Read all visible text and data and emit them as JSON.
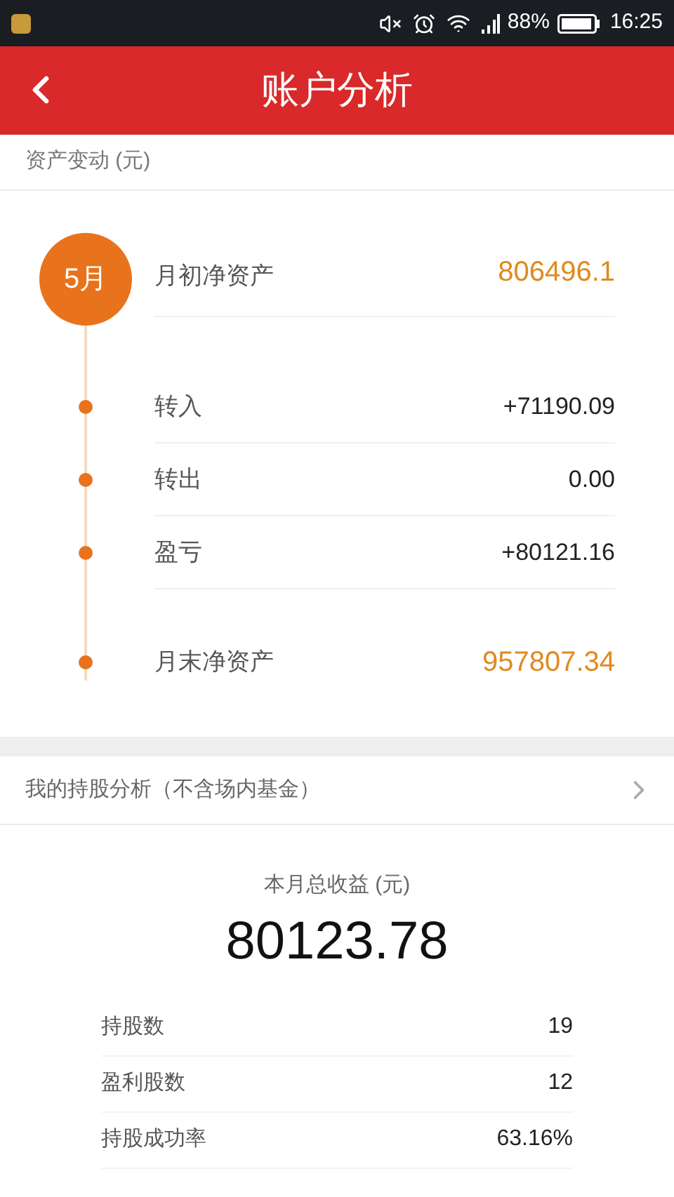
{
  "status_bar": {
    "battery": "88%",
    "time": "16:25"
  },
  "header": {
    "title": "账户分析"
  },
  "asset_section": {
    "title": "资产变动 (元)",
    "month": "5月",
    "rows": [
      {
        "kind": "start",
        "label": "月初净资产",
        "value": "806496.1"
      },
      {
        "kind": "flow",
        "label": "转入",
        "value": "+71190.09"
      },
      {
        "kind": "flow",
        "label": "转出",
        "value": "0.00"
      },
      {
        "kind": "flow",
        "label": "盈亏",
        "value": "+80121.16"
      },
      {
        "kind": "end",
        "label": "月末净资产",
        "value": "957807.34"
      }
    ]
  },
  "holdings": {
    "title": "我的持股分析（不含场内基金）",
    "total_label": "本月总收益 (元)",
    "total": "80123.78",
    "stats": [
      {
        "label": "持股数",
        "value": "19"
      },
      {
        "label": "盈利股数",
        "value": "12"
      },
      {
        "label": "持股成功率",
        "value": "63.16%"
      }
    ]
  }
}
